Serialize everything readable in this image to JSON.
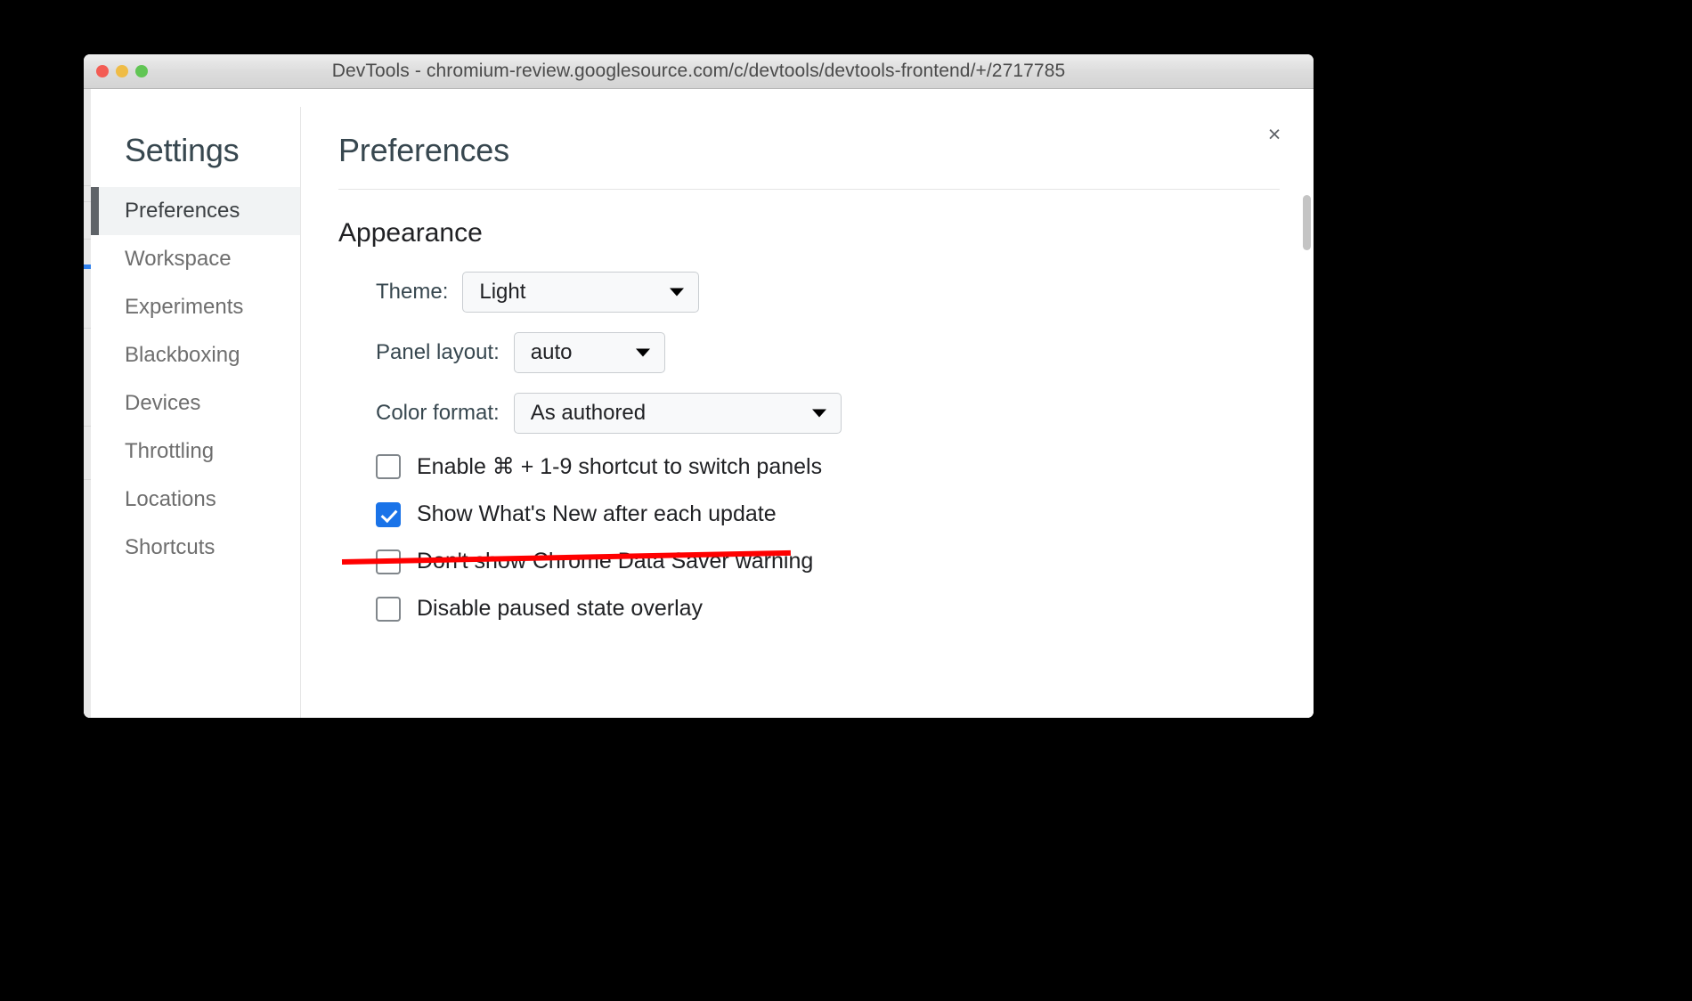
{
  "window": {
    "title": "DevTools - chromium-review.googlesource.com/c/devtools/devtools-frontend/+/2717785",
    "traffic_lights": {
      "close": "close-window-button",
      "minimize": "minimize-window-button",
      "zoom": "maximize-window-button"
    }
  },
  "dialog": {
    "close_label": "×"
  },
  "sidebar": {
    "title": "Settings",
    "items": [
      {
        "label": "Preferences",
        "selected": true
      },
      {
        "label": "Workspace",
        "selected": false
      },
      {
        "label": "Experiments",
        "selected": false
      },
      {
        "label": "Blackboxing",
        "selected": false
      },
      {
        "label": "Devices",
        "selected": false
      },
      {
        "label": "Throttling",
        "selected": false
      },
      {
        "label": "Locations",
        "selected": false
      },
      {
        "label": "Shortcuts",
        "selected": false
      }
    ]
  },
  "main": {
    "title": "Preferences",
    "section_title": "Appearance",
    "selects": [
      {
        "label": "Theme:",
        "value": "Light"
      },
      {
        "label": "Panel layout:",
        "value": "auto"
      },
      {
        "label": "Color format:",
        "value": "As authored"
      }
    ],
    "checkboxes": [
      {
        "label": "Enable ⌘ + 1-9 shortcut to switch panels",
        "checked": false,
        "struck": false
      },
      {
        "label": "Show What's New after each update",
        "checked": true,
        "struck": false
      },
      {
        "label": "Don't show Chrome Data Saver warning",
        "checked": false,
        "struck": true
      },
      {
        "label": "Disable paused state overlay",
        "checked": false,
        "struck": false
      }
    ]
  },
  "colors": {
    "accent": "#1a73e8",
    "strikethrough": "#ff0000",
    "selected_bg": "#f1f3f4",
    "selected_indicator": "#5f6368",
    "traffic_red": "#f35c54",
    "traffic_yellow": "#efbc46",
    "traffic_green": "#61c554"
  }
}
